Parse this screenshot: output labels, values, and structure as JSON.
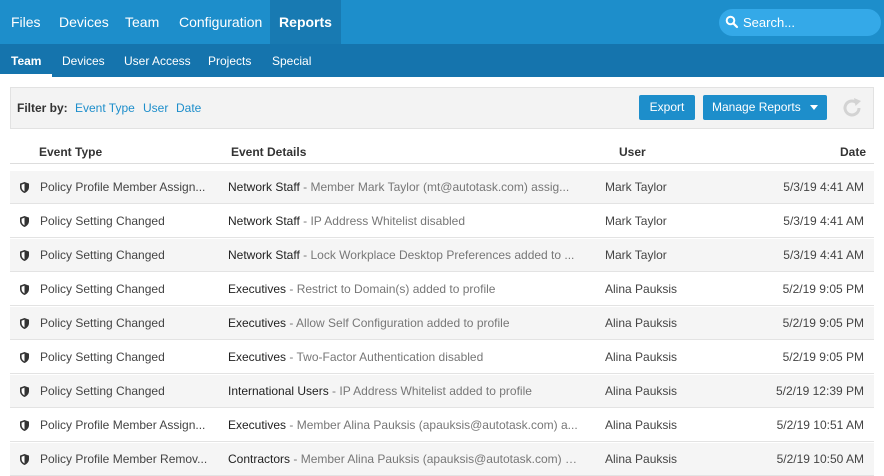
{
  "topnav": {
    "items": [
      "Files",
      "Devices",
      "Team",
      "Configuration",
      "Reports"
    ],
    "active": "Reports",
    "search_placeholder": "Search..."
  },
  "subnav": {
    "items": [
      "Team",
      "Devices",
      "User Access",
      "Projects",
      "Special"
    ],
    "active": "Team"
  },
  "filter": {
    "label": "Filter by:",
    "links": [
      "Event Type",
      "User",
      "Date"
    ],
    "export_label": "Export",
    "manage_label": "Manage Reports",
    "refresh_icon": "refresh-icon"
  },
  "table": {
    "headers": [
      "Event Type",
      "Event Details",
      "User",
      "Date"
    ],
    "rows": [
      {
        "event_type": "Policy Profile Member Assign...",
        "group": "Network Staff",
        "detail": " - Member Mark Taylor (mt@autotask.com) assig...",
        "user": "Mark Taylor",
        "date": "5/3/19 4:41 AM"
      },
      {
        "event_type": "Policy Setting Changed",
        "group": "Network Staff",
        "detail": " - IP Address Whitelist disabled",
        "user": "Mark Taylor",
        "date": "5/3/19 4:41 AM"
      },
      {
        "event_type": "Policy Setting Changed",
        "group": "Network Staff",
        "detail": " - Lock Workplace Desktop Preferences added to ...",
        "user": "Mark Taylor",
        "date": "5/3/19 4:41 AM"
      },
      {
        "event_type": "Policy Setting Changed",
        "group": "Executives",
        "detail": " - Restrict to Domain(s) added to profile",
        "user": "Alina Pauksis",
        "date": "5/2/19 9:05 PM"
      },
      {
        "event_type": "Policy Setting Changed",
        "group": "Executives",
        "detail": " - Allow Self Configuration added to profile",
        "user": "Alina Pauksis",
        "date": "5/2/19 9:05 PM"
      },
      {
        "event_type": "Policy Setting Changed",
        "group": "Executives",
        "detail": " - Two-Factor Authentication disabled",
        "user": "Alina Pauksis",
        "date": "5/2/19 9:05 PM"
      },
      {
        "event_type": "Policy Setting Changed",
        "group": "International Users",
        "detail": " - IP Address Whitelist added to profile",
        "user": "Alina Pauksis",
        "date": "5/2/19 12:39 PM"
      },
      {
        "event_type": "Policy Profile Member Assign...",
        "group": "Executives",
        "detail": " - Member Alina Pauksis (apauksis@autotask.com) a...",
        "user": "Alina Pauksis",
        "date": "5/2/19 10:51 AM"
      },
      {
        "event_type": "Policy Profile Member Remov...",
        "group": "Contractors",
        "detail": " - Member Alina Pauksis (apauksis@autotask.com) a...",
        "user": "Alina Pauksis",
        "date": "5/2/19 10:50 AM"
      }
    ]
  },
  "colors": {
    "topnav": "#1d8ecb",
    "subnav": "#1574ad",
    "accent": "#1d8ecb"
  },
  "row_icon": "shield-icon"
}
